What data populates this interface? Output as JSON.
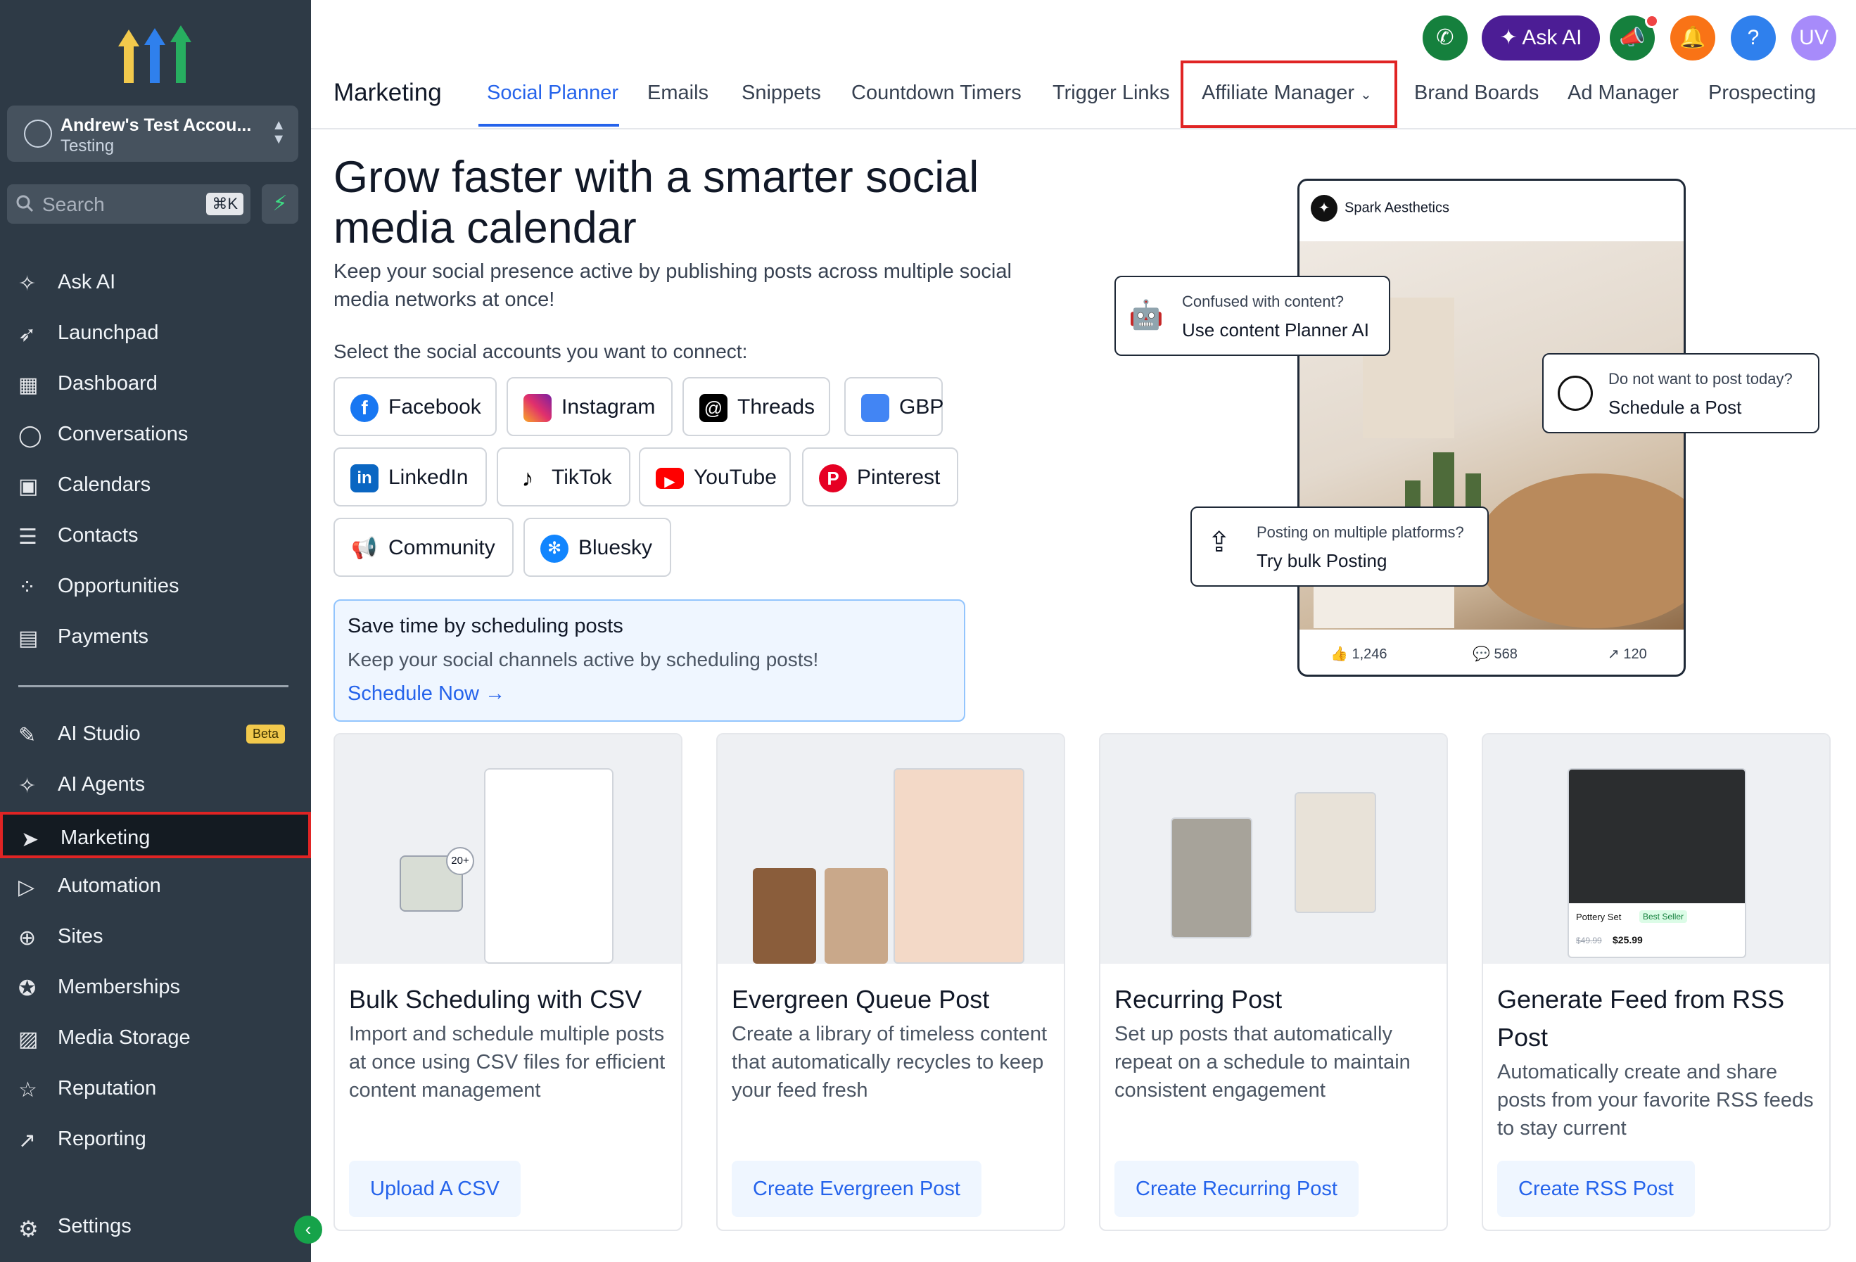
{
  "sidebar": {
    "account": {
      "name": "Andrew's Test Accou...",
      "subtitle": "Testing"
    },
    "search": {
      "placeholder": "Search",
      "shortcut": "⌘K"
    },
    "items": [
      {
        "label": "Ask AI",
        "icon": "sparkle-icon"
      },
      {
        "label": "Launchpad",
        "icon": "rocket-icon"
      },
      {
        "label": "Dashboard",
        "icon": "grid-icon"
      },
      {
        "label": "Conversations",
        "icon": "chat-bubble-icon"
      },
      {
        "label": "Calendars",
        "icon": "calendar-icon"
      },
      {
        "label": "Contacts",
        "icon": "contact-card-icon"
      },
      {
        "label": "Opportunities",
        "icon": "nodes-icon"
      },
      {
        "label": "Payments",
        "icon": "receipt-icon"
      }
    ],
    "items2": [
      {
        "label": "AI Studio",
        "icon": "ai-studio-icon",
        "badge": "Beta"
      },
      {
        "label": "AI Agents",
        "icon": "sparkle-icon"
      },
      {
        "label": "Marketing",
        "icon": "send-icon",
        "active": true
      },
      {
        "label": "Automation",
        "icon": "play-circle-icon"
      },
      {
        "label": "Sites",
        "icon": "globe-icon"
      },
      {
        "label": "Memberships",
        "icon": "badge-icon"
      },
      {
        "label": "Media Storage",
        "icon": "image-icon"
      },
      {
        "label": "Reputation",
        "icon": "star-icon"
      },
      {
        "label": "Reporting",
        "icon": "trend-icon"
      }
    ],
    "settings": "Settings"
  },
  "topbar": {
    "ask_ai": "Ask AI",
    "avatar": "UV",
    "help": "?",
    "brand": "Marketing",
    "tabs": [
      "Social Planner",
      "Emails",
      "Snippets",
      "Countdown Timers",
      "Trigger Links",
      "Affiliate Manager",
      "Brand Boards",
      "Ad Manager",
      "Prospecting"
    ],
    "selected_tab": "Social Planner"
  },
  "hero": {
    "title": "Grow faster with a smarter social media calendar",
    "subtitle": "Keep your social presence active by publishing posts across multiple social media networks at once!",
    "select_label": "Select the social accounts you want to connect:",
    "networks": [
      "Facebook",
      "Instagram",
      "Threads",
      "GBP",
      "LinkedIn",
      "TikTok",
      "YouTube",
      "Pinterest",
      "Community",
      "Bluesky"
    ]
  },
  "promo": {
    "title": "Save time by scheduling posts",
    "text": "Keep your social channels active by scheduling posts!",
    "cta": "Schedule Now"
  },
  "preview": {
    "account": "Spark Aesthetics",
    "likes": "1,246",
    "comments": "568",
    "shares": "120",
    "tip1": {
      "q": "Confused with content?",
      "a": "Use content Planner AI"
    },
    "tip2": {
      "q": "Do not want to post today?",
      "a": "Schedule a Post"
    },
    "tip3": {
      "q": "Posting on multiple platforms?",
      "a": "Try bulk Posting"
    }
  },
  "cards": [
    {
      "title": "Bulk Scheduling with CSV",
      "desc": "Import and schedule multiple posts at once using CSV files for efficient content management",
      "cta": "Upload A CSV"
    },
    {
      "title": "Evergreen Queue Post",
      "desc": "Create a library of timeless content that automatically recycles to keep your feed fresh",
      "cta": "Create Evergreen Post"
    },
    {
      "title": "Recurring Post",
      "desc": "Set up posts that automatically repeat on a schedule to maintain consistent engagement",
      "cta": "Create Recurring Post"
    },
    {
      "title": "Generate Feed from RSS Post",
      "desc": "Automatically create and share posts from your favorite RSS feeds to stay current",
      "cta": "Create RSS Post"
    }
  ],
  "card_art": {
    "bulk_badge": "20+",
    "pottery_name": "Pottery Set",
    "pottery_tag": "Best Seller",
    "pottery_old": "$49.99",
    "pottery_new": "$25.99"
  },
  "colors": {
    "sidebar": "#2e3a46",
    "accent": "#2563eb",
    "highlight": "#e02424",
    "askai": "#4c1d95"
  }
}
